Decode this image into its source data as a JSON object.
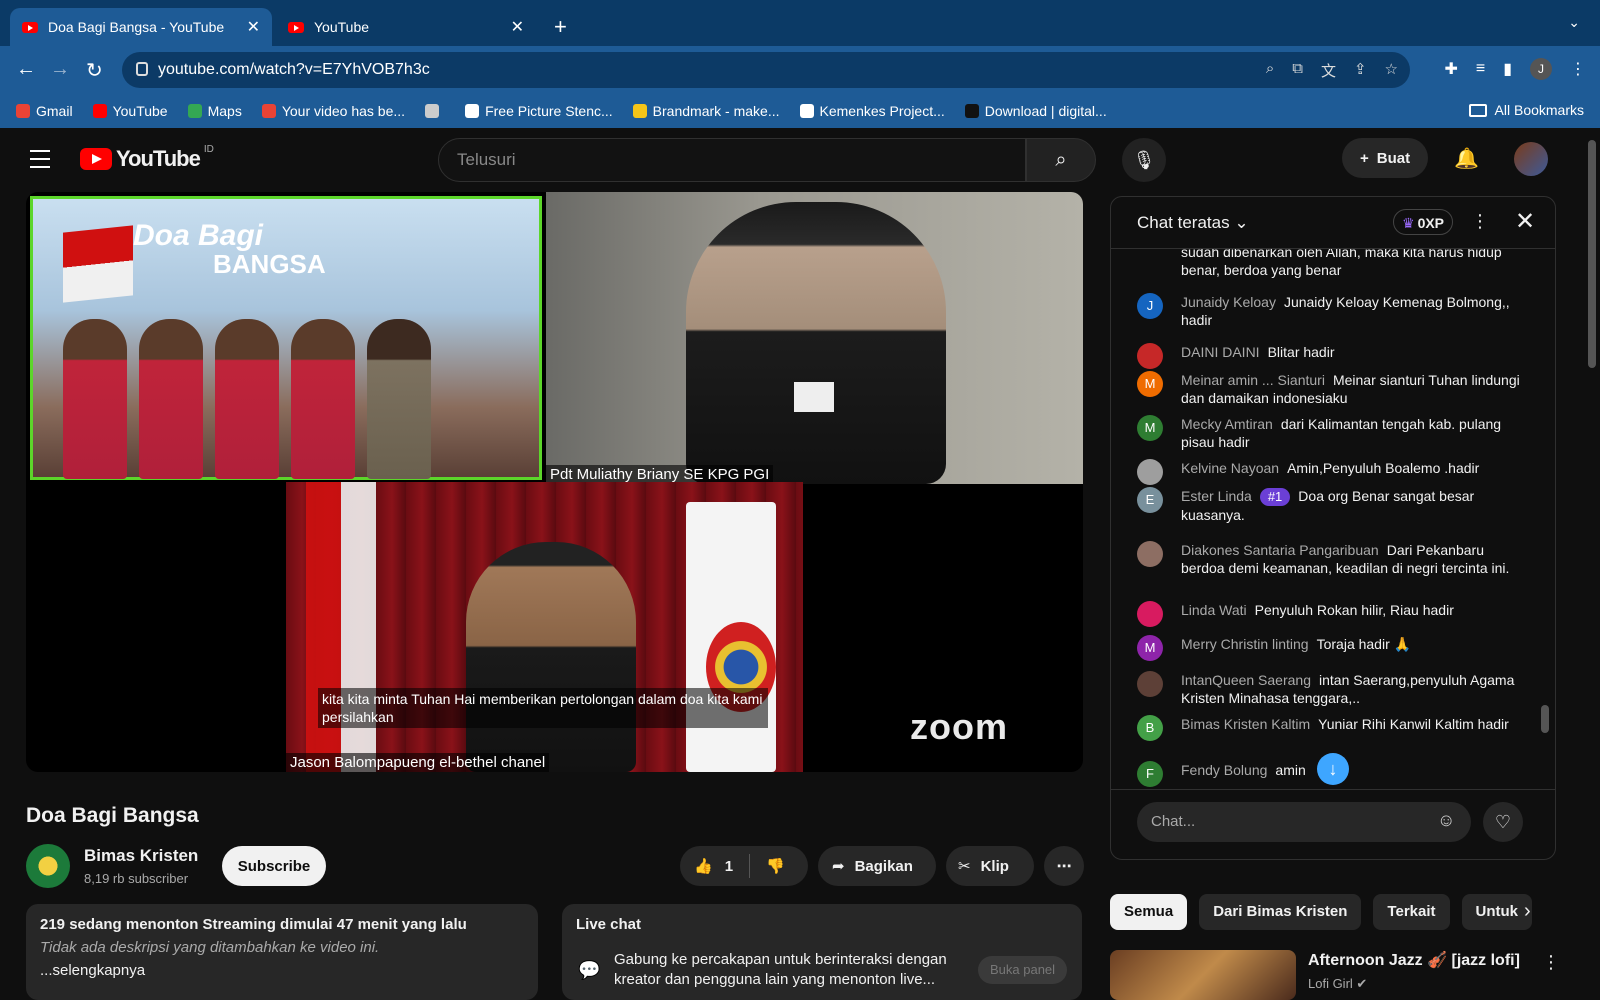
{
  "browser": {
    "tabs": [
      {
        "title": "Doa Bagi Bangsa - YouTube",
        "close": "✕"
      },
      {
        "title": "YouTube",
        "close": "✕"
      }
    ],
    "new_tab": "+",
    "url": "youtube.com/watch?v=E7YhVOB7h3c",
    "bookmarks": [
      {
        "label": "Gmail",
        "color": "#ea4335"
      },
      {
        "label": "YouTube",
        "color": "#ff0000"
      },
      {
        "label": "Maps",
        "color": "#34a853"
      },
      {
        "label": "Your video has be...",
        "color": "#ea4335"
      },
      {
        "label": "",
        "color": "#cccccc"
      },
      {
        "label": "Free Picture Stenc...",
        "color": "#ffffff"
      },
      {
        "label": "Brandmark - make...",
        "color": "#f5c518"
      },
      {
        "label": "Kemenkes Project...",
        "color": "#ffffff"
      },
      {
        "label": "Download | digital...",
        "color": "#111111"
      }
    ],
    "all_bookmarks": "All Bookmarks",
    "profile_initial": "J"
  },
  "youtube": {
    "logo_text": "YouTube",
    "country": "ID",
    "search_placeholder": "Telusuri",
    "create_label": "Buat"
  },
  "player": {
    "tile1_banner_line1": "Doa Bagi",
    "tile1_banner_line2": "BANGSA",
    "tile2_label": "Pdt Muliathy Briany SE KPG PGI",
    "tile3_label": "Jason Balompapueng el-bethel chanel",
    "subtitle": "kita kita minta Tuhan Hai memberikan pertolongan dalam doa kita kami persilahkan",
    "watermark": "zoom"
  },
  "video": {
    "title": "Doa Bagi Bangsa",
    "channel": "Bimas Kristen",
    "subscribers": "8,19 rb subscriber",
    "subscribe_label": "Subscribe",
    "likes": "1",
    "share_label": "Bagikan",
    "clip_label": "Klip",
    "stats": "219 sedang menonton  Streaming dimulai 47 menit yang lalu",
    "no_description": "Tidak ada deskripsi yang ditambahkan ke video ini.",
    "more": "...selengkapnya"
  },
  "live_chat_box": {
    "title": "Live chat",
    "body": "Gabung ke percakapan untuk berinteraksi dengan kreator dan pengguna lain yang menonton live...",
    "button": "Buka panel"
  },
  "chat": {
    "title": "Chat teratas",
    "xp": "0XP",
    "partial_message": "sudah dibenarkan oleh Allah, maka kita harus hidup benar, berdoa yang benar",
    "messages": [
      {
        "author": "Junaidy Keloay",
        "text": "Junaidy Keloay Kemenag Bolmong,, hadir",
        "initial": "J",
        "color": "#1565c0"
      },
      {
        "author": "DAINI DAINI",
        "text": "Blitar hadir",
        "initial": "",
        "color": "#c62828"
      },
      {
        "author": "Meinar amin ... Sianturi",
        "text": "Meinar sianturi Tuhan lindungi dan damaikan indonesiaku",
        "initial": "M",
        "color": "#ef6c00"
      },
      {
        "author": "Mecky Amtiran",
        "text": "dari Kalimantan tengah kab. pulang pisau hadir",
        "initial": "M",
        "color": "#2e7d32"
      },
      {
        "author": "Kelvine Nayoan",
        "text": "Amin,Penyuluh Boalemo .hadir",
        "initial": "",
        "color": "#9e9e9e"
      },
      {
        "author": "Ester Linda",
        "badge": "#1",
        "text": "Doa org Benar sangat besar kuasanya.",
        "initial": "E",
        "color": "#78909c"
      },
      {
        "author": "Diakones Santaria Pangaribuan",
        "text": "Dari Pekanbaru berdoa demi keamanan, keadilan di negri tercinta ini.",
        "initial": "",
        "color": "#8d6e63"
      },
      {
        "author": "Linda Wati",
        "text": "Penyuluh Rokan hilir, Riau hadir",
        "initial": "",
        "color": "#d81b60"
      },
      {
        "author": "Merry Christin linting",
        "text": "Toraja hadir 🙏",
        "initial": "M",
        "color": "#8e24aa"
      },
      {
        "author": "IntanQueen Saerang",
        "text": "intan Saerang,penyuluh Agama Kristen Minahasa tenggara,..",
        "initial": "",
        "color": "#5d4037"
      },
      {
        "author": "Bimas Kristen Kaltim",
        "text": "Yuniar Rihi Kanwil Kaltim hadir",
        "initial": "B",
        "color": "#43a047"
      },
      {
        "author": "Fendy Bolung",
        "text": "amin",
        "initial": "F",
        "color": "#2e7d32"
      }
    ],
    "input_placeholder": "Chat..."
  },
  "chips": [
    "Semua",
    "Dari Bimas Kristen",
    "Terkait",
    "Untuk"
  ],
  "recommendation": {
    "title": "Afternoon Jazz 🎻 [jazz lofi]",
    "channel": "Lofi Girl"
  }
}
